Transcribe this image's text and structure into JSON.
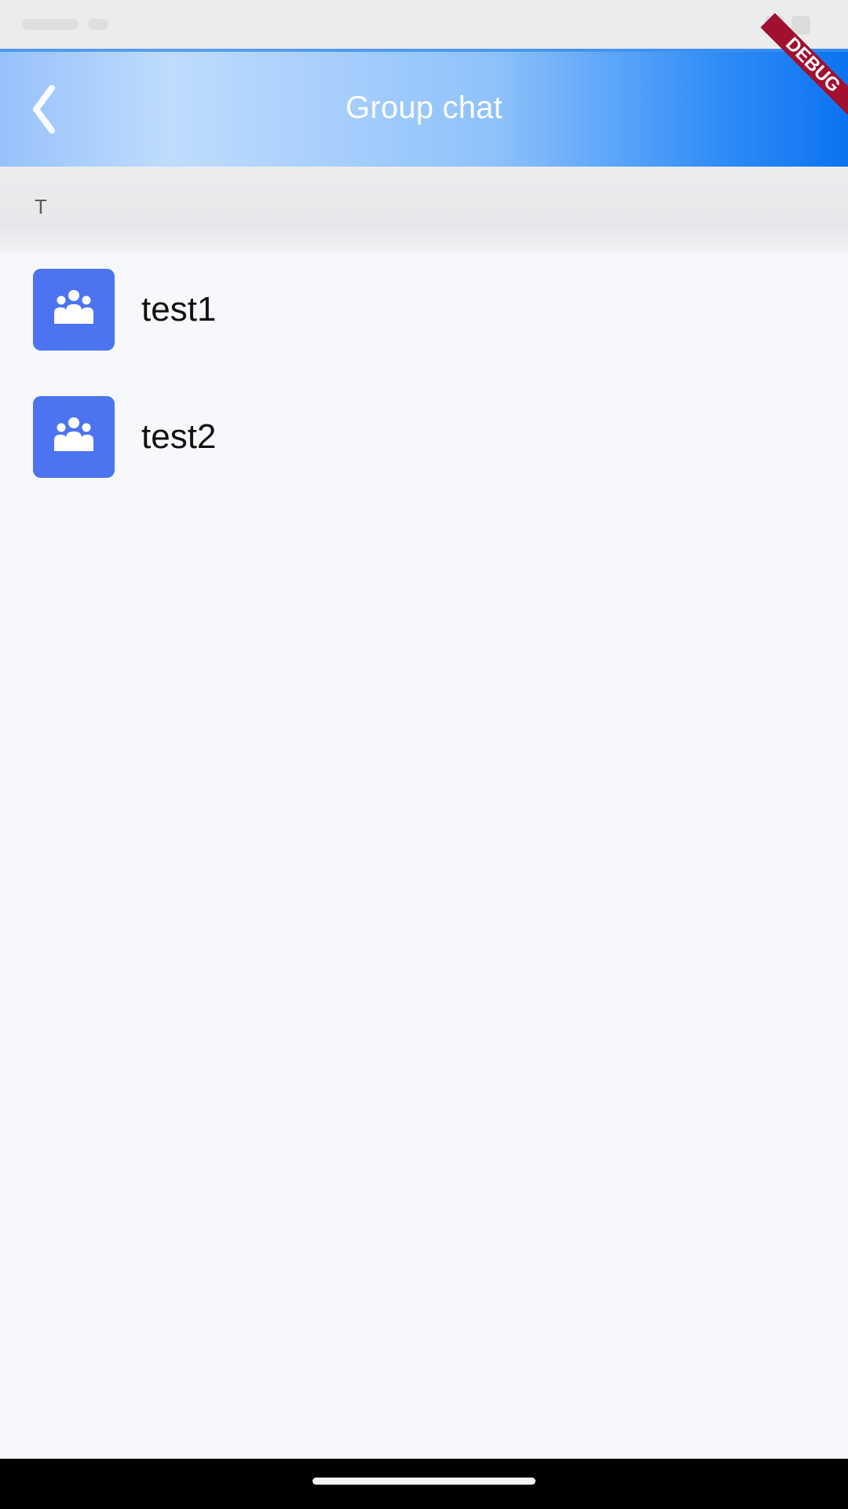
{
  "header": {
    "title": "Group chat",
    "back_icon": "back-arrow-icon"
  },
  "debug_banner": {
    "label": "DEBUG"
  },
  "section": {
    "letter": "T"
  },
  "groups": [
    {
      "name": "test1",
      "icon": "group-icon"
    },
    {
      "name": "test2",
      "icon": "group-icon"
    }
  ],
  "colors": {
    "app_bar_gradient_start": "#96c2fb",
    "app_bar_gradient_end": "#0b73f0",
    "avatar_bg": "#4c73f0",
    "section_header_bg": "#ececef",
    "page_bg": "#f7f8fb",
    "debug_banner_bg": "#a1102f"
  }
}
